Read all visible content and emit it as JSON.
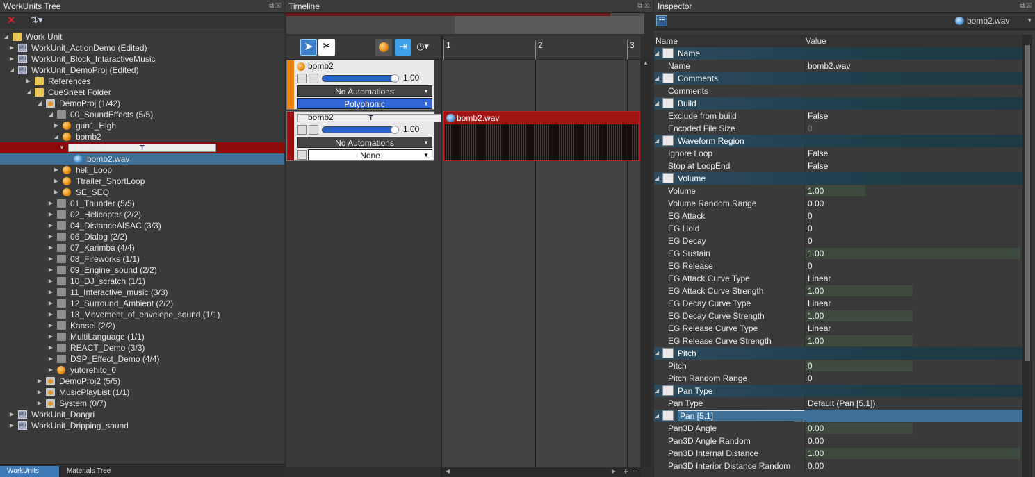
{
  "tree_panel": {
    "title": "WorkUnits Tree",
    "items": [
      {
        "label": "Work Unit",
        "icon": "folder-open",
        "depth": 0,
        "expanded": true
      },
      {
        "label": "WorkUnit_ActionDemo (Edited)",
        "icon": "workunit",
        "depth": 1
      },
      {
        "label": "WorkUnit_Block_IntaractiveMusic",
        "icon": "workunit",
        "depth": 1
      },
      {
        "label": "WorkUnit_DemoProj (Edited)",
        "icon": "workunit",
        "depth": 1,
        "expanded": true
      },
      {
        "label": "References",
        "icon": "folder",
        "depth": 2
      },
      {
        "label": "CueSheet Folder",
        "icon": "folder-open",
        "depth": 2,
        "expanded": true
      },
      {
        "label": "DemoProj (1/42)",
        "icon": "cuesheet",
        "depth": 3,
        "expanded": true
      },
      {
        "label": "00_SoundEffects (5/5)",
        "icon": "folder-open-gray",
        "depth": 4,
        "expanded": true
      },
      {
        "label": "gun1_High",
        "icon": "cue",
        "depth": 5
      },
      {
        "label": "bomb2",
        "icon": "cue",
        "depth": 5,
        "expanded": true
      },
      {
        "label": "bomb2",
        "icon": "track",
        "depth": 6,
        "selected": "red"
      },
      {
        "label": "bomb2.wav",
        "icon": "waveform",
        "depth": 7,
        "selected": "blue"
      },
      {
        "label": "heli_Loop",
        "icon": "cue",
        "depth": 5
      },
      {
        "label": "Ttrailer_ShortLoop",
        "icon": "cue",
        "depth": 5
      },
      {
        "label": "SE_SEQ",
        "icon": "cue",
        "depth": 5
      },
      {
        "label": "01_Thunder (5/5)",
        "icon": "folder-gray",
        "depth": 4
      },
      {
        "label": "02_Helicopter (2/2)",
        "icon": "folder-gray",
        "depth": 4
      },
      {
        "label": "04_DistanceAISAC (3/3)",
        "icon": "folder-gray",
        "depth": 4
      },
      {
        "label": "06_Dialog (2/2)",
        "icon": "folder-gray",
        "depth": 4
      },
      {
        "label": "07_Karimba (4/4)",
        "icon": "folder-gray",
        "depth": 4
      },
      {
        "label": "08_Fireworks (1/1)",
        "icon": "folder-gray",
        "depth": 4
      },
      {
        "label": "09_Engine_sound (2/2)",
        "icon": "folder-gray",
        "depth": 4
      },
      {
        "label": "10_DJ_scratch (1/1)",
        "icon": "folder-gray",
        "depth": 4
      },
      {
        "label": "11_Interactive_music (3/3)",
        "icon": "folder-gray",
        "depth": 4
      },
      {
        "label": "12_Surround_Ambient (2/2)",
        "icon": "folder-gray",
        "depth": 4
      },
      {
        "label": "13_Movement_of_envelope_sound (1/1)",
        "icon": "folder-gray",
        "depth": 4
      },
      {
        "label": "Kansei (2/2)",
        "icon": "folder-gray",
        "depth": 4
      },
      {
        "label": "MultiLanguage (1/1)",
        "icon": "folder-gray",
        "depth": 4
      },
      {
        "label": "REACT_Demo (3/3)",
        "icon": "folder-gray",
        "depth": 4
      },
      {
        "label": "DSP_Effect_Demo (4/4)",
        "icon": "folder-gray",
        "depth": 4
      },
      {
        "label": "yutorehito_0",
        "icon": "cue",
        "depth": 4
      },
      {
        "label": "DemoProj2 (5/5)",
        "icon": "cuesheet",
        "depth": 3
      },
      {
        "label": "MusicPlayList (1/1)",
        "icon": "cuesheet",
        "depth": 3
      },
      {
        "label": "System (0/7)",
        "icon": "cuesheet",
        "depth": 3
      },
      {
        "label": "WorkUnit_Dongri",
        "icon": "workunit",
        "depth": 1
      },
      {
        "label": "WorkUnit_Dripping_sound",
        "icon": "workunit",
        "depth": 1
      }
    ],
    "bottom_tabs": [
      "WorkUnits Tree",
      "Materials Tree"
    ]
  },
  "timeline": {
    "title": "Timeline",
    "ruler_marks": [
      "1",
      "2",
      "3"
    ],
    "tracks": [
      {
        "name": "bomb2",
        "volume": "1.00",
        "automation": "No Automations",
        "mode": "Polyphonic",
        "color": "#f08010"
      },
      {
        "name": "bomb2",
        "volume": "1.00",
        "automation": "No Automations",
        "mode": "None",
        "color": "#9a1010"
      }
    ],
    "clip_label": "bomb2.wav"
  },
  "inspector": {
    "title": "Inspector",
    "object_name": "bomb2.wav",
    "col_name": "Name",
    "col_value": "Value",
    "rows": [
      {
        "type": "cat",
        "label": "Name",
        "icon": "name-icon"
      },
      {
        "label": "Name",
        "value": "bomb2.wav"
      },
      {
        "type": "cat",
        "label": "Comments",
        "icon": "comment-icon"
      },
      {
        "label": "Comments",
        "value": ""
      },
      {
        "type": "cat",
        "label": "Build",
        "icon": "build-icon"
      },
      {
        "label": "Exclude from build",
        "value": "False"
      },
      {
        "label": "Encoded File Size",
        "value": "0",
        "disabled": true
      },
      {
        "type": "cat",
        "label": "Waveform Region",
        "icon": "waveform-region-icon"
      },
      {
        "label": "Ignore Loop",
        "value": "False"
      },
      {
        "label": "Stop at LoopEnd",
        "value": "False"
      },
      {
        "type": "cat",
        "label": "Volume",
        "icon": "speaker-icon"
      },
      {
        "label": "Volume",
        "value": "1.00",
        "bar": 0.28
      },
      {
        "label": "Volume Random Range",
        "value": "0.00"
      },
      {
        "label": "EG Attack",
        "value": "0"
      },
      {
        "label": "EG Hold",
        "value": "0"
      },
      {
        "label": "EG Decay",
        "value": "0"
      },
      {
        "label": "EG Sustain",
        "value": "1.00",
        "bar": 1.0
      },
      {
        "label": "EG Release",
        "value": "0"
      },
      {
        "label": "EG Attack Curve Type",
        "value": "Linear"
      },
      {
        "label": "EG Attack Curve Strength",
        "value": "1.00",
        "bar": 0.5
      },
      {
        "label": "EG Decay Curve Type",
        "value": "Linear"
      },
      {
        "label": "EG Decay Curve Strength",
        "value": "1.00",
        "bar": 0.5
      },
      {
        "label": "EG Release Curve Type",
        "value": "Linear"
      },
      {
        "label": "EG Release Curve Strength",
        "value": "1.00",
        "bar": 0.5
      },
      {
        "type": "cat",
        "label": "Pitch",
        "icon": "pitch-icon"
      },
      {
        "label": "Pitch",
        "value": "0",
        "bar": 0.5
      },
      {
        "label": "Pitch Random Range",
        "value": "0"
      },
      {
        "type": "cat",
        "label": "Pan Type",
        "icon": "pan-type-icon"
      },
      {
        "label": "Pan Type",
        "value": "Default (Pan [5.1])"
      },
      {
        "type": "cat",
        "label": "Pan [5.1]",
        "icon": "pan-icon",
        "selected": true
      },
      {
        "label": "Pan3D Angle",
        "value": "0.00",
        "bar": 0.5
      },
      {
        "label": "Pan3D Angle Random",
        "value": "0.00"
      },
      {
        "label": "Pan3D Internal Distance",
        "value": "1.00",
        "bar": 1.0
      },
      {
        "label": "Pan3D Interior Distance Random",
        "value": "0.00"
      }
    ]
  }
}
